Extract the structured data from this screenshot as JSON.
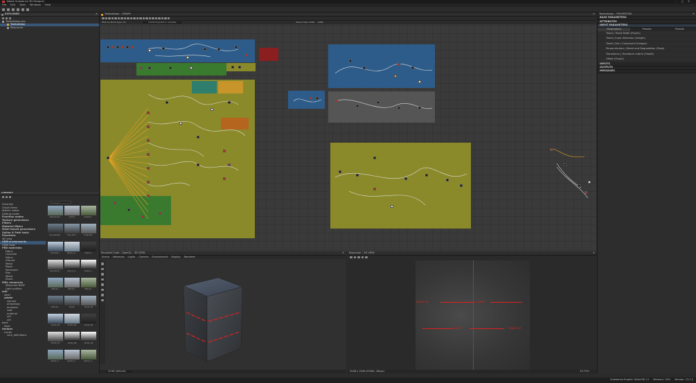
{
  "app": {
    "title": "Adobe Substance 3D Designer",
    "menu": [
      "File",
      "Edit",
      "Tools",
      "Windows",
      "Help"
    ]
  },
  "explorer": {
    "title": "EXPLORER",
    "tree": [
      {
        "label": "Testhalldoor.sbs",
        "level": 0
      },
      {
        "label": "Testhalldoor",
        "level": 1,
        "selected": true
      },
      {
        "label": "Resources",
        "level": 1
      }
    ]
  },
  "graph": {
    "tab_title": "Testhalldoor - GRAPH",
    "filter_label": "Filter by Node Type: All",
    "combining_label": "Combining text or variable",
    "parent_size_label": "Parent Size: 2048",
    "size_value": "2048"
  },
  "library": {
    "title": "LIBRARY",
    "search_placeholder": "Search",
    "categories": [
      "Favorites",
      "Graph Items",
      "Atomic nodes",
      "Folding nodes",
      "Function nodes",
      "Texture generators",
      "Filters",
      "Material filters",
      "Mesh-based generators",
      "Spline & Path tools",
      "Functions",
      "3D view",
      "HDRI environments",
      "HDRI tools",
      "PBR materials",
      "Fabric",
      "Concrete",
      "Fabric",
      "Ground",
      "Metal",
      "Paper",
      "Pavement",
      "Plas",
      "Wood",
      "Stone",
      "MDL resources",
      "Measured BSDF",
      "Light profiles",
      "mdl",
      "label",
      "adobe",
      "volume",
      "anisotropy",
      "emission",
      "coat",
      "material",
      "util",
      "util",
      "base",
      "base",
      "toolbox",
      "nvidia",
      "core_definitions"
    ],
    "selected_category": "HDRI environments",
    "thumbs": [
      [
        "abandoned...",
        "airport",
        "bamboo..."
      ],
      [
        "bus_garage...",
        "cave_entr...",
        "crossroad..."
      ],
      [
        "Colorado...",
        "glacier_p...",
        "interior..."
      ],
      [
        "panorama...",
        "road_in_t...",
        "small_in..."
      ],
      [
        "Soft_Ro...",
        "Soft_Ro...",
        "Soft_Ro..."
      ],
      [
        "Soft_Ub...",
        "studio",
        "studio_03"
      ],
      [
        "studio_04",
        "studio_05",
        "studio_06"
      ],
      [
        "studio_07",
        "studio_08",
        "studio_09"
      ],
      [
        "studio_1...",
        "studio_1...",
        "studio_1..."
      ]
    ]
  },
  "properties": {
    "title": "Testhalldoor - PROPERTIES",
    "sections": [
      "BASE PARAMETERS",
      "ATTRIBUTES",
      "INPUT PARAMETERS"
    ],
    "tabs": [
      "Parameters",
      "Presets",
      "Presets"
    ],
    "params": [
      "Tread | Tread Width (Float1)",
      "Tread | Input Selection (Integer)",
      "Tread | Dot | Compound (Integer)",
      "Perpendiculars | Bevel and Degradation (Float)",
      "Transforms | Transform matrix (Float4)",
      "Offset (Float2)"
    ],
    "sections2": [
      "INPUTS",
      "OUTPUTS",
      "MESSAGES"
    ]
  },
  "view3d": {
    "title": "Rounded Cube - OpenGL - 3D VIEW",
    "menu": [
      "Scene",
      "Materials",
      "Lights",
      "Camera",
      "Environment",
      "Display",
      "Renderer"
    ],
    "status": "2048 (default)"
  },
  "view2d": {
    "title": "Basecolor - 2D VIEW",
    "status": "2048 x 2048 (RGBA, 16bpc)",
    "zoom": "35.79%",
    "labels_top": [
      "ɹǝʇuǝɔ ɹǝ",
      "ɹǝʇuǝɔ"
    ],
    "labels_bottom": [
      "Ɛ ɹǝuɹoɔ",
      "lunch",
      "ɹǝʇuǝɔ ɹǝ"
    ]
  },
  "statusbar": {
    "engine": "Substance Engine: Direct3D 11",
    "memory": "Memory: 19%",
    "version": "Version: 13.1.2"
  },
  "colors": {
    "frame_blue": "#2e5c8a",
    "frame_green": "#3a7a2e",
    "frame_olive": "#8a8a2a",
    "frame_gray": "#555555",
    "frame_red": "#8b1e1e",
    "frame_orange": "#b5651d",
    "frame_teal": "#2f7d6d",
    "accent": "#3b5777"
  }
}
